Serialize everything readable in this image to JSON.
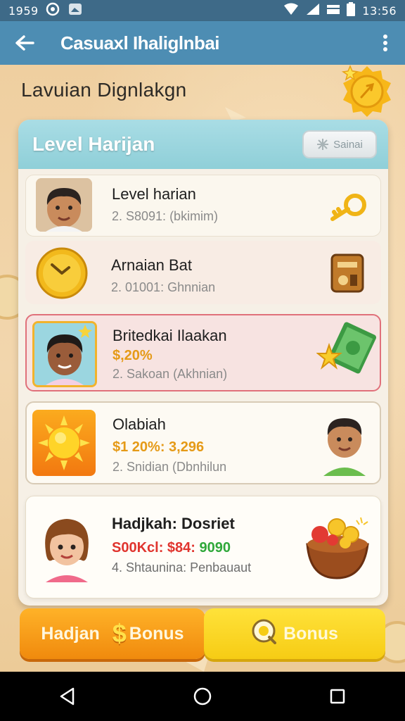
{
  "status_bar": {
    "time_left": "1959",
    "time_right": "13:56"
  },
  "app_bar": {
    "title": "Casuaxl Ihaliglnbai"
  },
  "page": {
    "heading": "Lavuian Dignlakgn"
  },
  "panel": {
    "title": "Level Harijan",
    "header_button": "Sainai",
    "rows": [
      {
        "name": "Level harian",
        "sub": "2. S8091: (bkimim)"
      },
      {
        "name": "Arnaian Bat",
        "sub": "2. 01001: Ghnnian"
      },
      {
        "name": "Britedkai Ilaakan",
        "amount": "$,20%",
        "sub": "2. Sakoan (Akhnian)"
      },
      {
        "name": "Olabiah",
        "amount": "$1 20%: 3,296",
        "sub": "2. Snidian (Dbnhilun"
      },
      {
        "name": "Hadjkah: Dosriet",
        "amount_red": "S00Kcl: $84:",
        "amount_green": "9090",
        "sub": "4. Shtaunina: Penbauaut"
      }
    ]
  },
  "buttons": {
    "left_label_a": "Hadjan",
    "left_label_b": "Bonus",
    "right_label": "Bonus"
  },
  "colors": {
    "status_bar": "#3e6a88",
    "app_bar": "#4d8db3",
    "panel_header": "#9fd6df",
    "orange_button": "#f59a18",
    "yellow_button": "#f8d21c",
    "highlight_row_border": "#e0707a"
  }
}
